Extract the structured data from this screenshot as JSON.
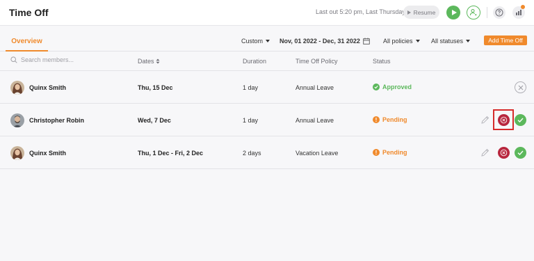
{
  "header": {
    "title": "Time Off",
    "last_out": "Last out 5:20 pm, Last Thursday",
    "resume_label": "Resume"
  },
  "toolbar": {
    "tab_overview": "Overview",
    "range_mode": "Custom",
    "date_range": "Nov, 01 2022 - Dec, 31 2022",
    "policies_filter": "All policies",
    "statuses_filter": "All statuses",
    "add_button": "Add Time Off"
  },
  "table": {
    "search_placeholder": "Search members...",
    "columns": {
      "dates": "Dates",
      "duration": "Duration",
      "policy": "Time Off Policy",
      "status": "Status"
    },
    "rows": [
      {
        "member": "Quinx Smith",
        "dates": "Thu, 15 Dec",
        "duration": "1 day",
        "policy": "Annual Leave",
        "status": "Approved"
      },
      {
        "member": "Christopher Robin",
        "dates": "Wed, 7 Dec",
        "duration": "1 day",
        "policy": "Annual Leave",
        "status": "Pending"
      },
      {
        "member": "Quinx Smith",
        "dates": "Thu, 1 Dec - Fri, 2 Dec",
        "duration": "2 days",
        "policy": "Vacation Leave",
        "status": "Pending"
      }
    ]
  },
  "colors": {
    "accent": "#f08a2c",
    "approved": "#5cb85c",
    "reject": "#b8273e",
    "highlight": "#d62b2b"
  },
  "icons": [
    "play-icon",
    "person-clock-icon",
    "help-icon",
    "apps-icon",
    "search-icon",
    "calendar-icon",
    "sort-icon",
    "edit-icon",
    "reject-icon",
    "approve-icon",
    "cancel-icon"
  ]
}
